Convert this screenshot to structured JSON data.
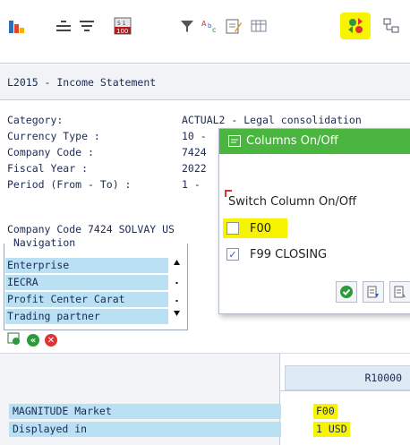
{
  "toolbar": {
    "icons": [
      "bar-chart-icon",
      "align-lines-icon",
      "filter-lines-icon",
      "calendar-100-icon",
      "filter-funnel-icon",
      "text-format-icon",
      "edit-document-icon",
      "table-icon",
      "columns-toggle-icon",
      "hierarchy-icon"
    ],
    "calendar_label_top": "5 1",
    "calendar_label": "100",
    "highlight_color": "#f8f400"
  },
  "report": {
    "title": "L2015 - Income Statement"
  },
  "header_fields": [
    {
      "label": "Category:",
      "value": "ACTUAL2 - Legal consolidation"
    },
    {
      "label": "Currency Type :",
      "value": "10 -"
    },
    {
      "label": "Company Code :",
      "value": "7424"
    },
    {
      "label": "Fiscal Year :",
      "value": "2022"
    },
    {
      "label": "Period (From - To) :",
      "value": "1 -"
    }
  ],
  "company_line": "Company Code 7424 SOLVAY US",
  "navigation": {
    "title": "Navigation",
    "items": [
      "Enterprise",
      "IECRA",
      "Profit Center Carat",
      "Trading partner"
    ]
  },
  "grid": {
    "column_header": "R10000",
    "rows": [
      {
        "label": "MAGNITUDE Market",
        "value": "F00"
      },
      {
        "label": "Displayed in",
        "value": "1 USD"
      }
    ]
  },
  "popup": {
    "title": "Columns On/Off",
    "section_label": "Switch Column On/Off",
    "options": [
      {
        "label": "F00",
        "checked": false
      },
      {
        "label": "F99 CLOSING",
        "checked": true
      }
    ],
    "header_color": "#4ab53f"
  }
}
